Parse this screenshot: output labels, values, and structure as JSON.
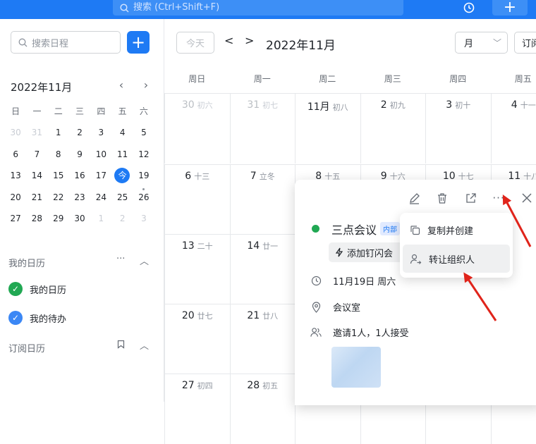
{
  "topbar": {
    "search_placeholder": "搜索 (Ctrl+Shift+F)",
    "history_icon": "history-icon",
    "add_label": "+"
  },
  "sidebar": {
    "search_placeholder": "搜索日程",
    "add_label": "+",
    "mini_calendar": {
      "title": "2022年11月",
      "weekdays": [
        "日",
        "一",
        "二",
        "三",
        "四",
        "五",
        "六"
      ],
      "today_label": "今"
    },
    "my_calendars": {
      "heading": "我的日历",
      "items": [
        {
          "label": "我的日历",
          "color": "#21a853"
        },
        {
          "label": "我的待办",
          "color": "#3b87f5"
        }
      ]
    },
    "subscribed": {
      "heading": "订阅日历"
    }
  },
  "toolbar": {
    "today_label": "今天",
    "month_title": "2022年11月",
    "view_select": "月",
    "subscribe_label": "订阅"
  },
  "month_view": {
    "weekdays": [
      "周日",
      "周一",
      "周二",
      "周三",
      "周四",
      "周五"
    ],
    "rows": [
      [
        {
          "d": "30",
          "l": "初六",
          "o": true
        },
        {
          "d": "31",
          "l": "初七",
          "o": true
        },
        {
          "d": "11月",
          "l": "初八"
        },
        {
          "d": "2",
          "l": "初九"
        },
        {
          "d": "3",
          "l": "初十"
        },
        {
          "d": "4",
          "l": "十一"
        }
      ],
      [
        {
          "d": "6",
          "l": "十三"
        },
        {
          "d": "7",
          "l": "立冬"
        },
        {
          "d": "8",
          "l": "十五"
        },
        {
          "d": "9",
          "l": "十六"
        },
        {
          "d": "10",
          "l": "十七"
        },
        {
          "d": "11",
          "l": "十八"
        }
      ],
      [
        {
          "d": "13",
          "l": "二十"
        },
        {
          "d": "14",
          "l": "廿一"
        },
        {
          "d": "",
          "l": ""
        },
        {
          "d": "",
          "l": ""
        },
        {
          "d": "",
          "l": ""
        },
        {
          "d": "",
          "l": ""
        }
      ],
      [
        {
          "d": "20",
          "l": "廿七"
        },
        {
          "d": "21",
          "l": "廿八"
        },
        {
          "d": "",
          "l": ""
        },
        {
          "d": "",
          "l": ""
        },
        {
          "d": "",
          "l": ""
        },
        {
          "d": "",
          "l": ""
        }
      ],
      [
        {
          "d": "27",
          "l": "初四"
        },
        {
          "d": "28",
          "l": "初五"
        },
        {
          "d": "",
          "l": ""
        },
        {
          "d": "",
          "l": ""
        },
        {
          "d": "",
          "l": ""
        },
        {
          "d": "",
          "l": ""
        }
      ]
    ]
  },
  "event_popup": {
    "title": "三点会议",
    "tag": "内部",
    "flash_button": "添加钉闪会",
    "date": "11月19日 周六",
    "location": "会议室",
    "attendees": "邀请1人，1人接受",
    "status_color": "#21a853"
  },
  "more_menu": {
    "items": [
      {
        "label": "复制并创建"
      },
      {
        "label": "转让组织人"
      }
    ]
  }
}
